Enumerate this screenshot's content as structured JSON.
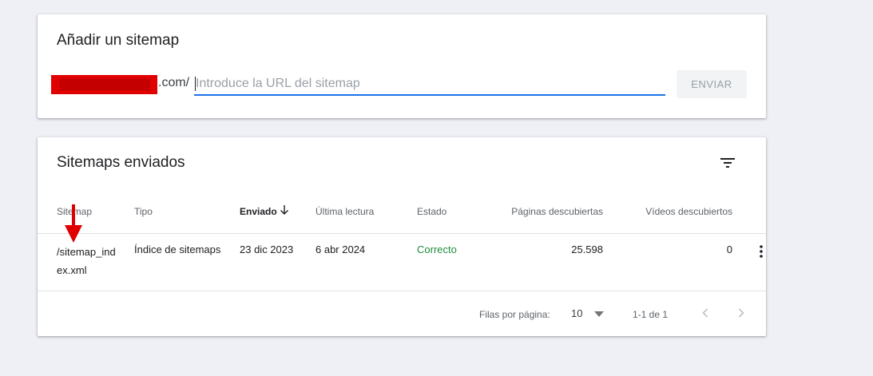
{
  "add_sitemap": {
    "title": "Añadir un sitemap",
    "domain_suffix": ".com/",
    "url_placeholder": "Introduce la URL del sitemap",
    "url_value": "",
    "submit_label": "ENVIAR"
  },
  "submitted": {
    "title": "Sitemaps enviados",
    "columns": {
      "sitemap": "Sitemap",
      "type": "Tipo",
      "submitted": "Enviado",
      "last_read": "Última lectura",
      "status": "Estado",
      "pages": "Páginas descubiertas",
      "videos": "Vídeos descubiertos"
    },
    "rows": [
      {
        "sitemap": "/sitemap_index.xml",
        "type": "Índice de sitemaps",
        "submitted": "23 dic 2023",
        "last_read": "6 abr 2024",
        "status": "Correcto",
        "pages": "25.598",
        "videos": "0"
      }
    ],
    "footer": {
      "rows_per_page_label": "Filas por página:",
      "rows_per_page_value": "10",
      "range": "1-1 de 1"
    }
  },
  "colors": {
    "accent": "#1a73e8",
    "status_ok": "#1e8e3e",
    "annotation": "#e00000",
    "background": "#eef0f6"
  },
  "icons": {
    "filter": "filter-list-icon",
    "sort": "arrow-down-icon",
    "more": "more-vert-icon",
    "dropdown": "dropdown-arrow-icon",
    "prev": "chevron-left-icon",
    "next": "chevron-right-icon"
  }
}
